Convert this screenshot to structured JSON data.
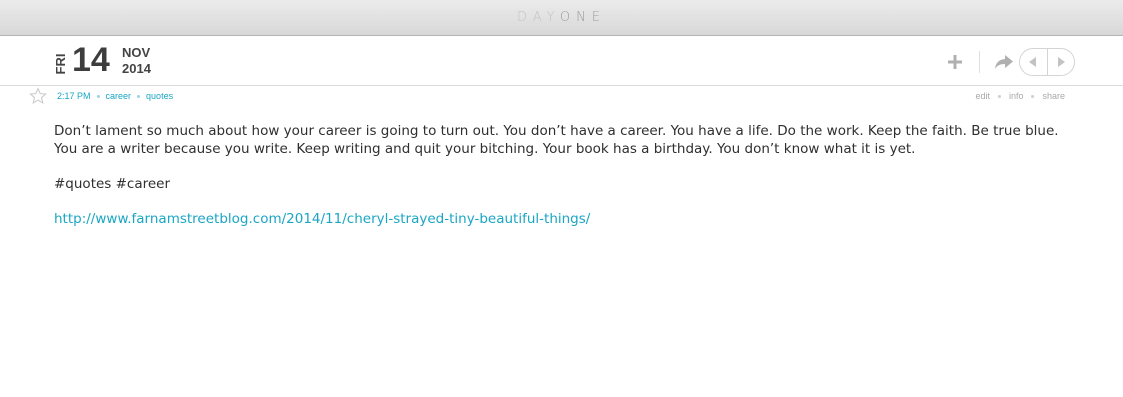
{
  "window": {
    "title_part1": "DAY",
    "title_part2": "ONE"
  },
  "date": {
    "weekday": "FRI",
    "day": "14",
    "month": "NOV",
    "year": "2014"
  },
  "toolbar": {
    "add_icon": "plus-icon",
    "share_icon": "share-arrow-icon",
    "prev_icon": "chevron-left-icon",
    "next_icon": "chevron-right-icon"
  },
  "meta": {
    "time": "2:17 PM",
    "tags": [
      "career",
      "quotes"
    ],
    "actions": [
      "edit",
      "info",
      "share"
    ]
  },
  "entry": {
    "body": "Don’t lament so much about how your career is going to turn out. You don’t have a career. You have a life. Do the work. Keep the faith. Be true blue. You are a writer because you write. Keep writing and quit your bitching. Your book has a birthday. You don’t know what it is yet.",
    "hashtags": "#quotes #career",
    "link": "http://www.farnamstreetblog.com/2014/11/cheryl-strayed-tiny-beautiful-things/"
  },
  "colors": {
    "accent": "#1aa6c4",
    "text": "#2f2f2f",
    "muted": "#a9a9a9"
  }
}
